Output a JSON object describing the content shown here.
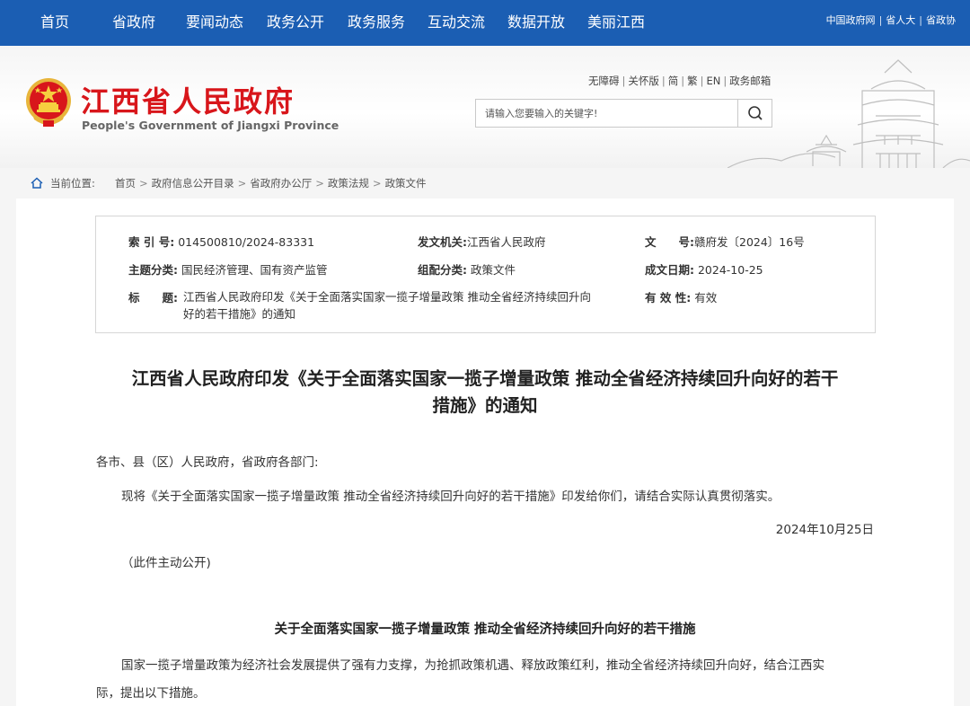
{
  "nav": {
    "items": [
      "首页",
      "省政府",
      "要闻动态",
      "政务公开",
      "政务服务",
      "互动交流",
      "数据开放",
      "美丽江西"
    ],
    "links": [
      "中国政府网",
      "省人大",
      "省政协"
    ]
  },
  "header": {
    "title": "江西省人民政府",
    "subtitle": "People's Government of Jiangxi Province",
    "util_links": [
      "无障碍",
      "关怀版",
      "简",
      "繁",
      "EN",
      "政务邮箱"
    ],
    "search_placeholder": "请输入您要输入的关键字!"
  },
  "breadcrumb": {
    "label": "当前位置:",
    "items": [
      "首页",
      "政府信息公开目录",
      "省政府办公厅",
      "政策法规",
      "政策文件"
    ]
  },
  "meta": {
    "index_label": "索 引 号:",
    "index_value": "014500810/2024-83331",
    "issuer_label": "发文机关:",
    "issuer_value": "江西省人民政府",
    "docno_label": "文　　号:",
    "docno_value": "赣府发〔2024〕16号",
    "category_label": "主题分类:",
    "category_value": "国民经济管理、国有资产监管",
    "type_label": "组配分类:",
    "type_value": "政策文件",
    "date_label": "成文日期:",
    "date_value": "2024-10-25",
    "title_label": "标　　题:",
    "title_line1": "江西省人民政府印发《关于全面落实国家一揽子增量政策 推动全省经济持续回升向",
    "title_line2": "好的若干措施》的通知",
    "validity_label": "有 效 性:",
    "validity_value": "有效"
  },
  "article": {
    "title_line1": "江西省人民政府印发《关于全面落实国家一揽子增量政策 推动全省经济持续回升向好的若干",
    "title_line2": "措施》的通知",
    "salutation": "各市、县（区）人民政府，省政府各部门:",
    "body1": "现将《关于全面落实国家一揽子增量政策 推动全省经济持续回升向好的若干措施》印发给你们，请结合实际认真贯彻落实。",
    "date": "2024年10月25日",
    "note": "（此件主动公开)",
    "section_title": "关于全面落实国家一揽子增量政策 推动全省经济持续回升向好的若干措施",
    "intro_line1": "国家一揽子增量政策为经济社会发展提供了强有力支撑，为抢抓政策机遇、释放政策红利，推动全省经济持续回升向好，结合江西实",
    "intro_line2": "际，提出以下措施。"
  },
  "colors": {
    "nav_blue": "#1b5eb3",
    "title_red": "#d8161b"
  }
}
